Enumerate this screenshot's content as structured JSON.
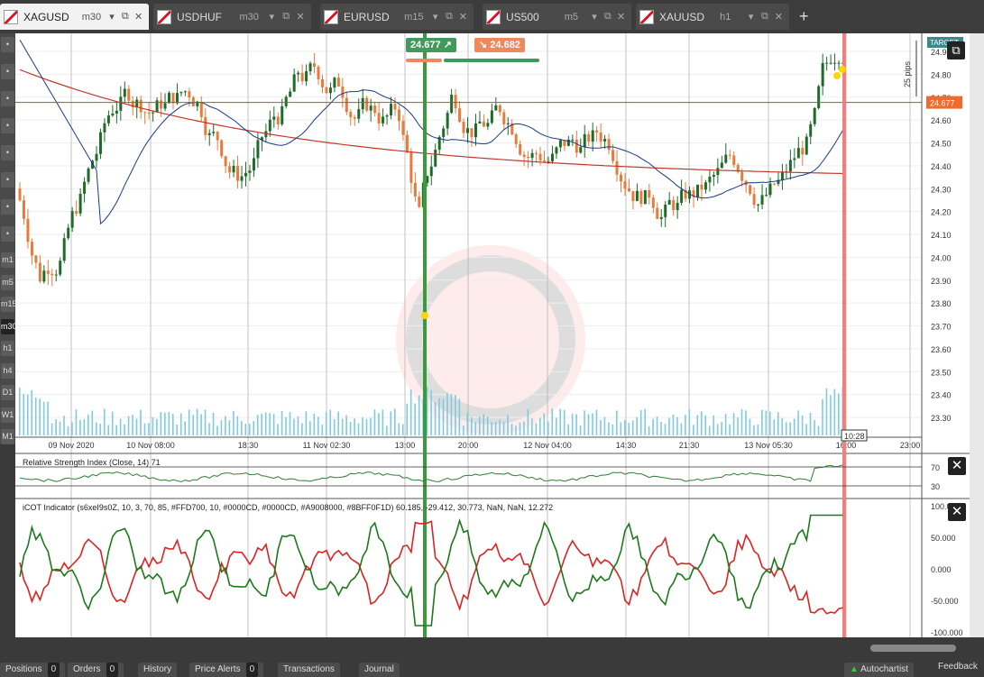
{
  "tabs": [
    {
      "symbol": "XAGUSD",
      "timeframe": "m30",
      "active": true
    },
    {
      "symbol": "USDHUF",
      "timeframe": "m30",
      "active": false
    },
    {
      "symbol": "EURUSD",
      "timeframe": "m15",
      "active": false
    },
    {
      "symbol": "US500",
      "timeframe": "m5",
      "active": false
    },
    {
      "symbol": "XAUUSD",
      "timeframe": "h1",
      "active": false
    }
  ],
  "left_toolbar": [
    "m1",
    "m5",
    "m15",
    "m30",
    "h1",
    "h4",
    "D1",
    "W1",
    "M1"
  ],
  "left_toolbar_selected": "m30",
  "trade": {
    "sell_price": "24.677",
    "buy_price": "24.682"
  },
  "price_axis": {
    "labels": [
      "24.90",
      "24.80",
      "24.70",
      "24.60",
      "24.50",
      "24.40",
      "24.30",
      "24.20",
      "24.10",
      "24.00",
      "23.90",
      "23.80",
      "23.70",
      "23.60",
      "23.50",
      "23.40",
      "23.30"
    ],
    "current": "24.677",
    "target": "TARGET",
    "pips": "25 pips"
  },
  "time_axis": {
    "labels": [
      "09 Nov 2020",
      "10 Nov 08:00",
      "18:30",
      "11 Nov 02:30",
      "13:00",
      "20:00",
      "12 Nov 04:00",
      "14:30",
      "21:30",
      "13 Nov 05:30",
      "16:00",
      "23:00"
    ],
    "crosshair": "10:28"
  },
  "rsi": {
    "title": "Relative Strength Index (Close, 14) 71",
    "levels": [
      "70",
      "30"
    ]
  },
  "icot": {
    "title": "iCOT Indicator (s6xeI9s0Z, 10, 3, 70, 85, #FFD700, 10, #0000CD, #0000CD, #A9008000, #8BFF0F1D) 60.185, -29.412, 30.773, NaN, NaN, 12.272",
    "levels": [
      "100.000",
      "50.000",
      "0.000",
      "-50.000",
      "-100.000"
    ]
  },
  "bottom_tabs": [
    {
      "label": "Positions",
      "count": "0"
    },
    {
      "label": "Orders",
      "count": "0"
    },
    {
      "label": "History",
      "count": ""
    },
    {
      "label": "Price Alerts",
      "count": "0"
    },
    {
      "label": "Transactions",
      "count": ""
    },
    {
      "label": "Journal",
      "count": ""
    }
  ],
  "autochartist": "Autochartist",
  "feedback": "Feedback",
  "colors": {
    "bull": "#1f6b2a",
    "bear": "#e87b3c",
    "ma_red": "#c0392b",
    "ma_blue": "#1a3a8a",
    "green_line": "#3b9a3b",
    "pink_line": "#f08080",
    "volume": "#7ecbe0"
  }
}
